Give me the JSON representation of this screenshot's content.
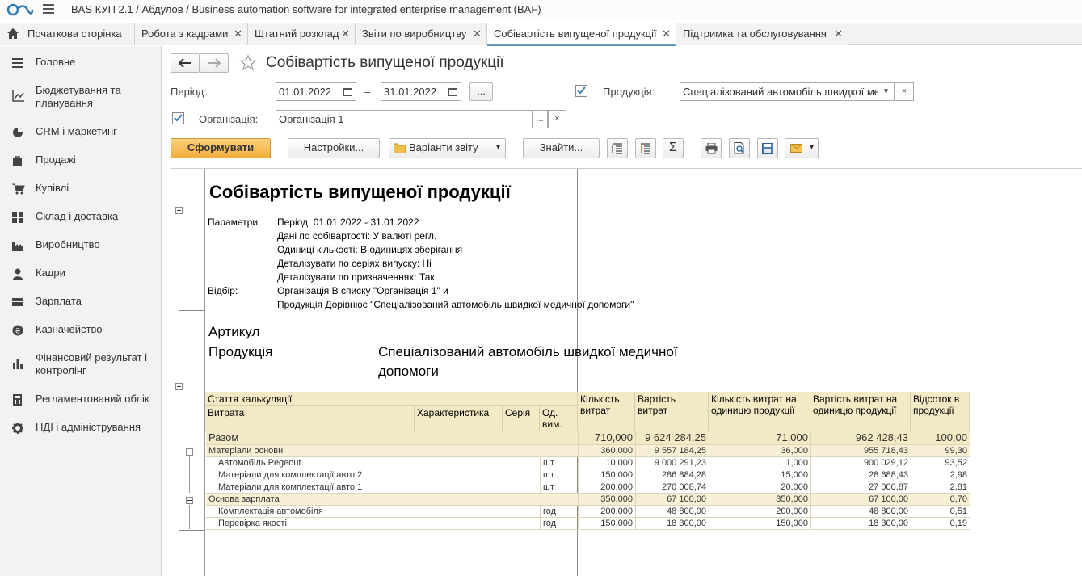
{
  "app": {
    "title": "BAS КУП 2.1 / Абдулов / Business automation software for integrated enterprise management  (BAF)"
  },
  "tabs": [
    {
      "label": "Початкова сторінка"
    },
    {
      "label": "Робота з кадрами"
    },
    {
      "label": "Штатний розклад"
    },
    {
      "label": "Звіти по виробництву"
    },
    {
      "label": "Собівартість випущеної продукції"
    },
    {
      "label": "Підтримка та обслуговування"
    }
  ],
  "sidebar": {
    "items": [
      {
        "label": "Головне",
        "icon": "menu-lines-icon"
      },
      {
        "label": "Бюджетування та планування",
        "icon": "chart-line-icon"
      },
      {
        "label": "CRM і маркетинг",
        "icon": "pie-chart-icon"
      },
      {
        "label": "Продажі",
        "icon": "shopping-bag-icon"
      },
      {
        "label": "Купівлі",
        "icon": "cart-icon"
      },
      {
        "label": "Склад і доставка",
        "icon": "grid-icon"
      },
      {
        "label": "Виробництво",
        "icon": "factory-icon"
      },
      {
        "label": "Кадри",
        "icon": "person-icon"
      },
      {
        "label": "Зарплата",
        "icon": "wallet-icon"
      },
      {
        "label": "Казначейство",
        "icon": "coin-icon"
      },
      {
        "label": "Фінансовий результат і контролінг",
        "icon": "bar-chart-icon"
      },
      {
        "label": "Регламентований облік",
        "icon": "calculator-icon"
      },
      {
        "label": "НДІ і адміністрування",
        "icon": "gear-icon"
      }
    ]
  },
  "form": {
    "title": "Собівартість випущеної продукції",
    "period_label": "Період:",
    "date_from": "01.01.2022",
    "dash": "–",
    "date_to": "31.01.2022",
    "ellipsis": "...",
    "product_label": "Продукція:",
    "product_value": "Спеціалізований автомобіль швидкої ме,",
    "org_label": "Організація:",
    "org_value": "Організація 1",
    "clear": "×"
  },
  "toolbar": {
    "generate": "Сформувати",
    "settings": "Настройки...",
    "variants": "Варіанти звіту",
    "find": "Знайти..."
  },
  "report": {
    "title": "Собівартість випущеної продукції",
    "params_label": "Параметри:",
    "params": [
      "Період: 01.01.2022 - 31.01.2022",
      "Дані по собівартості: У валюті регл.",
      "Одиниці кількості: В одиницях зберігання",
      "Деталізувати по серіях випуску: Ні",
      "Деталізувати по призначеннях: Так"
    ],
    "filter_label": "Відбір:",
    "filters": [
      "Організація В списку \"Організація 1\" и",
      "Продукція Дорівнює \"Спеціалізований автомобіль швидкої медичної допомоги\""
    ],
    "article_label": "Артикул",
    "product_label": "Продукція",
    "product_line1": "Спеціалізований автомобіль швидкої медичної",
    "product_line2": "допомоги",
    "headers": {
      "cost_item": "Стаття калькуляції",
      "expense": "Витрата",
      "characteristic": "Характеристика",
      "series": "Серія",
      "unit": "Од. вим.",
      "qty": "Кількість витрат",
      "cost": "Вартість витрат",
      "qty_per_unit": "Кількість витрат на одиницю продукції",
      "cost_per_unit": "Вартість витрат на одиницю продукції",
      "percent": "Відсоток в продукції"
    },
    "total": {
      "label": "Разом",
      "qty": "710,000",
      "cost": "9 624 284,25",
      "qpu": "71,000",
      "cpu": "962 428,43",
      "pct": "100,00"
    },
    "rows": [
      {
        "type": "group",
        "name": "Матеріали основні",
        "unit": "",
        "qty": "360,000",
        "cost": "9 557 184,25",
        "qpu": "36,000",
        "cpu": "955 718,43",
        "pct": "99,30"
      },
      {
        "type": "item",
        "name": "Автомобіль Pegeout",
        "unit": "шт",
        "qty": "10,000",
        "cost": "9 000 291,23",
        "qpu": "1,000",
        "cpu": "900 029,12",
        "pct": "93,52"
      },
      {
        "type": "item",
        "name": "Матеріали для комплектації авто 2",
        "unit": "шт",
        "qty": "150,000",
        "cost": "286 884,28",
        "qpu": "15,000",
        "cpu": "28 688,43",
        "pct": "2,98"
      },
      {
        "type": "item",
        "name": "Матеріали для комплектації авто 1",
        "unit": "шт",
        "qty": "200,000",
        "cost": "270 008,74",
        "qpu": "20,000",
        "cpu": "27 000,87",
        "pct": "2,81"
      },
      {
        "type": "group",
        "name": "Основа зарплата",
        "unit": "",
        "qty": "350,000",
        "cost": "67 100,00",
        "qpu": "350,000",
        "cpu": "67 100,00",
        "pct": "0,70"
      },
      {
        "type": "item",
        "name": "Комплектація автомобіля",
        "unit": "год",
        "qty": "200,000",
        "cost": "48 800,00",
        "qpu": "200,000",
        "cpu": "48 800,00",
        "pct": "0,51"
      },
      {
        "type": "item",
        "name": "Перевірка якості",
        "unit": "год",
        "qty": "150,000",
        "cost": "18 300,00",
        "qpu": "150,000",
        "cpu": "18 300,00",
        "pct": "0,19"
      }
    ]
  },
  "colors": {
    "accent": "#f6b74a",
    "header_bg": "#f3e9c4",
    "group_bg": "#f7f0d5",
    "check": "#3c7fb5"
  }
}
